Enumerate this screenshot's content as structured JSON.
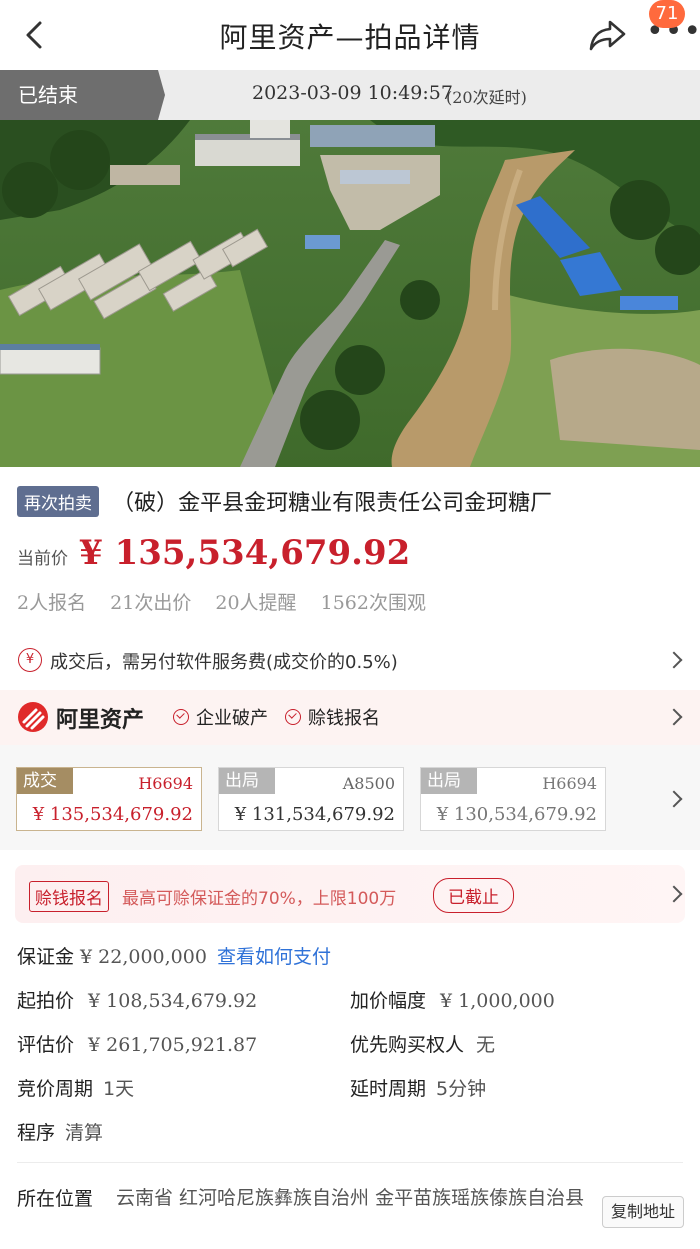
{
  "header": {
    "title": "阿里资产—拍品详情",
    "notification_count": "71",
    "more_symbol": "•••"
  },
  "status_bar": {
    "state_label": "已结束",
    "end_time": "2023-03-09 10:49:57",
    "extension_note": "(20次延时)"
  },
  "item": {
    "tag": "再次拍卖",
    "title": "（破）金平县金珂糖业有限责任公司金珂糖厂",
    "current_price_label": "当前价",
    "current_price": "¥ 135,534,679.92",
    "stats": [
      "2人报名",
      "21次出价",
      "20人提醒",
      "1562次围观"
    ]
  },
  "fee": {
    "icon_symbol": "¥",
    "text": "成交后，需另付软件服务费(成交价的0.5%)"
  },
  "ali_banner": {
    "brand": "阿里资产",
    "badges": [
      "企业破产",
      "赊钱报名"
    ]
  },
  "bids": [
    {
      "status": "成交",
      "code": "H6694",
      "amount": "¥ 135,534,679.92"
    },
    {
      "status": "出局",
      "code": "A8500",
      "amount": "¥ 131,534,679.92"
    },
    {
      "status": "出局",
      "code": "H6694",
      "amount": "¥ 130,534,679.92"
    }
  ],
  "loan": {
    "tag": "赊钱报名",
    "description": "最高可赊保证金的70%，上限100万",
    "state": "已截止"
  },
  "details": {
    "deposit_label": "保证金",
    "deposit_value": "¥ 22,000,000",
    "deposit_link": "查看如何支付",
    "start_price_label": "起拍价",
    "start_price_value": "¥ 108,534,679.92",
    "increment_label": "加价幅度",
    "increment_value": "¥ 1,000,000",
    "appraisal_label": "评估价",
    "appraisal_value": "¥ 261,705,921.87",
    "priority_label": "优先购买权人",
    "priority_value": "无",
    "cycle_label": "竞价周期",
    "cycle_value": "1天",
    "delay_label": "延时周期",
    "delay_value": "5分钟",
    "procedure_label": "程序",
    "procedure_value": "清算"
  },
  "location": {
    "label": "所在位置",
    "value": "云南省 红河哈尼族彝族自治州 金平苗族瑶族傣族自治县",
    "copy_button": "复制地址"
  },
  "colors": {
    "price_red": "#c8202c",
    "tag_slate": "#5f6e90",
    "link_blue": "#2f72d8",
    "badge_orange": "#ff6a3d"
  }
}
